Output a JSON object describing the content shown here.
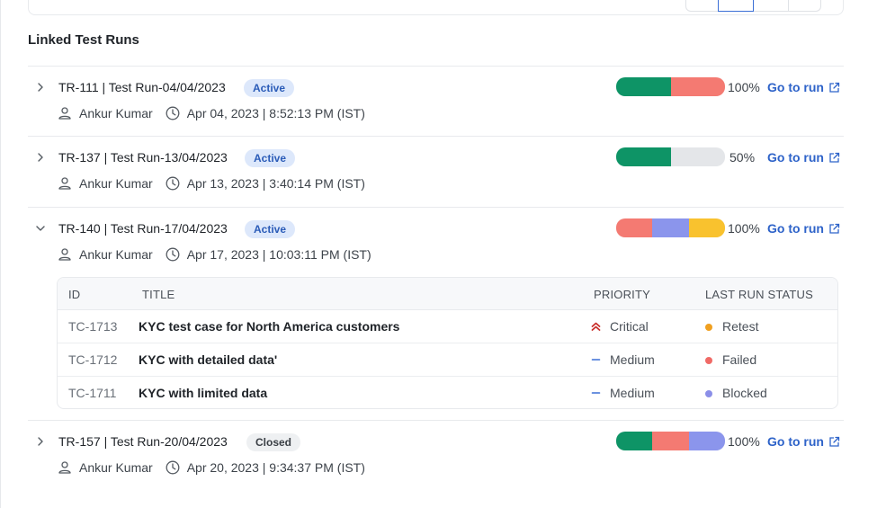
{
  "section_title": "Linked Test Runs",
  "runs": [
    {
      "id_title": "TR-111 | Test Run-04/04/2023",
      "status": "Active",
      "assignee": "Ankur Kumar",
      "date": "Apr 04, 2023 | 8:52:13 PM (IST)",
      "percent_label": "100%",
      "segments": [
        {
          "fraction": 0.5,
          "color": "#0e9466"
        },
        {
          "fraction": 0.5,
          "color": "#f47a72"
        }
      ],
      "go_label": "Go to run",
      "expanded": false
    },
    {
      "id_title": "TR-137 | Test Run-13/04/2023",
      "status": "Active",
      "assignee": "Ankur Kumar",
      "date": "Apr 13, 2023 | 3:40:14 PM (IST)",
      "percent_label": "50%",
      "segments": [
        {
          "fraction": 0.5,
          "color": "#0e9466"
        }
      ],
      "go_label": "Go to run",
      "expanded": false
    },
    {
      "id_title": "TR-140 | Test Run-17/04/2023",
      "status": "Active",
      "assignee": "Ankur Kumar",
      "date": "Apr 17, 2023 | 10:03:11 PM (IST)",
      "percent_label": "100%",
      "segments": [
        {
          "fraction": 0.333,
          "color": "#f47a72"
        },
        {
          "fraction": 0.334,
          "color": "#8b95ec"
        },
        {
          "fraction": 0.333,
          "color": "#f9c22e"
        }
      ],
      "go_label": "Go to run",
      "expanded": true
    },
    {
      "id_title": "TR-157 | Test Run-20/04/2023",
      "status": "Closed",
      "assignee": "Ankur Kumar",
      "date": "Apr 20, 2023 | 9:34:37 PM (IST)",
      "percent_label": "100%",
      "segments": [
        {
          "fraction": 0.333,
          "color": "#0e9466"
        },
        {
          "fraction": 0.334,
          "color": "#f47a72"
        },
        {
          "fraction": 0.333,
          "color": "#8b95ec"
        }
      ],
      "go_label": "Go to run",
      "expanded": false
    }
  ],
  "test_cases": {
    "headers": {
      "id": "ID",
      "title": "TITLE",
      "priority": "PRIORITY",
      "status": "LAST RUN STATUS"
    },
    "rows": [
      {
        "id": "TC-1713",
        "title": "KYC test case for North America customers",
        "priority": "Critical",
        "priority_icon": "double-chevron-up-icon",
        "status": "Retest",
        "status_color": "#f0a020"
      },
      {
        "id": "TC-1712",
        "title": "KYC with detailed data'",
        "priority": "Medium",
        "priority_icon": "dash-icon",
        "status": "Failed",
        "status_color": "#f06a66"
      },
      {
        "id": "TC-1711",
        "title": "KYC with limited data",
        "priority": "Medium",
        "priority_icon": "dash-icon",
        "status": "Blocked",
        "status_color": "#8b8fe8"
      }
    ]
  }
}
